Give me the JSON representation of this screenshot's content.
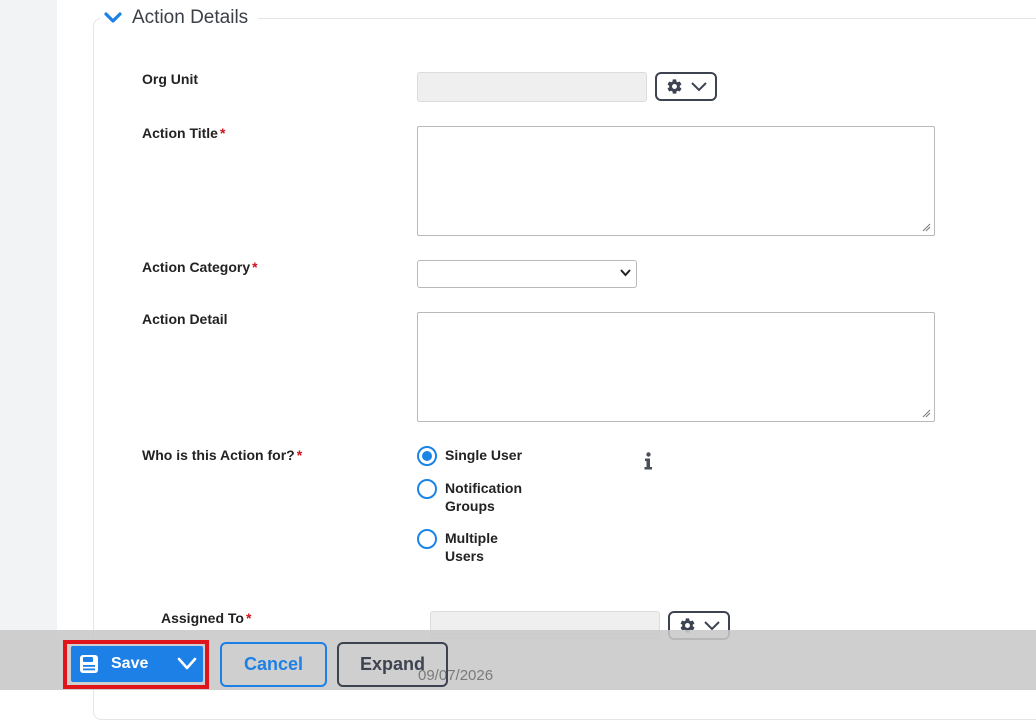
{
  "section": {
    "title": "Action Details"
  },
  "fields": {
    "org_unit": {
      "label": "Org Unit",
      "value": ""
    },
    "action_title": {
      "label": "Action Title",
      "required_mark": "*",
      "value": ""
    },
    "action_category": {
      "label": "Action Category",
      "required_mark": "*",
      "selected": ""
    },
    "action_detail": {
      "label": "Action Detail",
      "value": ""
    },
    "who_for": {
      "label": "Who is this Action for?",
      "required_mark": "*",
      "options": [
        {
          "label": "Single User",
          "checked": true
        },
        {
          "label": "Notification Groups",
          "checked": false
        },
        {
          "label": "Multiple Users",
          "checked": false
        }
      ]
    },
    "assigned_to": {
      "label": "Assigned To",
      "required_mark": "*",
      "value": ""
    },
    "date_value": "09/07/2026"
  },
  "footer": {
    "save_label": "Save",
    "cancel_label": "Cancel",
    "expand_label": "Expand"
  },
  "colors": {
    "primary": "#1d80e6",
    "required": "#d0121b",
    "highlight": "#e0141b",
    "dark_outline": "#3d4350"
  },
  "icons": [
    "chevron-down-icon",
    "gear-icon",
    "info-icon",
    "save-icon"
  ]
}
